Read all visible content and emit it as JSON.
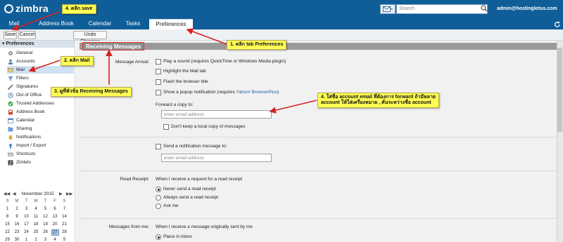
{
  "app": {
    "logo_text": "zimbra",
    "user": "admin@hostinglotus.com"
  },
  "search": {
    "placeholder": "Search"
  },
  "tabs": [
    {
      "label": "Mail"
    },
    {
      "label": "Address Book"
    },
    {
      "label": "Calendar"
    },
    {
      "label": "Tasks"
    },
    {
      "label": "Preferences"
    }
  ],
  "toolbar": {
    "save_label": "Save",
    "cancel_label": "Cancel",
    "undo_label": "Undo Changes"
  },
  "sidebar": {
    "header": "Preferences",
    "items": [
      {
        "label": "General",
        "icon": "gear-icon"
      },
      {
        "label": "Accounts",
        "icon": "person-icon"
      },
      {
        "label": "Mail",
        "icon": "envelope-icon"
      },
      {
        "label": "Filters",
        "icon": "filter-icon"
      },
      {
        "label": "Signatures",
        "icon": "pen-icon"
      },
      {
        "label": "Out of Office",
        "icon": "clock-icon"
      },
      {
        "label": "Trusted Addresses",
        "icon": "check-icon"
      },
      {
        "label": "Address Book",
        "icon": "book-icon"
      },
      {
        "label": "Calendar",
        "icon": "calendar-icon"
      },
      {
        "label": "Sharing",
        "icon": "share-icon"
      },
      {
        "label": "Notifications",
        "icon": "bell-icon"
      },
      {
        "label": "Import / Export",
        "icon": "import-icon"
      },
      {
        "label": "Shortcuts",
        "icon": "keyboard-icon"
      },
      {
        "label": "Zimlets",
        "icon": "zimlet-icon"
      }
    ]
  },
  "calendar": {
    "title": "November 2015",
    "days": [
      "S",
      "M",
      "T",
      "W",
      "T",
      "F",
      "S"
    ],
    "rows": [
      [
        "1",
        "2",
        "3",
        "4",
        "5",
        "6",
        "7"
      ],
      [
        "8",
        "9",
        "10",
        "11",
        "12",
        "13",
        "14"
      ],
      [
        "15",
        "16",
        "17",
        "18",
        "19",
        "20",
        "21"
      ],
      [
        "22",
        "23",
        "24",
        "25",
        "26",
        "27",
        "28"
      ],
      [
        "29",
        "30",
        "1",
        "2",
        "3",
        "4",
        "5"
      ]
    ],
    "today": "27"
  },
  "section": {
    "title": "Receiving Messages"
  },
  "message_arrival": {
    "label": "Message Arrival:",
    "options": [
      "Play a sound (requires QuickTime or Windows Media plugin)",
      "Highlight the Mail tab",
      "Flash the browser title"
    ],
    "popup_prefix": "Show a popup notification (requires ",
    "popup_link": "Yahoo! BrowserPlus",
    "popup_suffix": ")",
    "forward_label": "Forward a copy to:",
    "forward_placeholder": "enter email address",
    "dont_keep": "Don't keep a local copy of messages",
    "notify_label": "Send a notification message to:",
    "notify_placeholder": "enter email address"
  },
  "read_receipt": {
    "label": "Read Receipt:",
    "intro": "When I receive a request for a read receipt",
    "options": [
      "Never send a read receipt",
      "Always send a read receipt",
      "Ask me"
    ]
  },
  "messages_from_me": {
    "label": "Messages from me:",
    "intro": "When I receive a message originally sent by me",
    "options": [
      "Place in Inbox"
    ]
  },
  "annotations": {
    "step1": "1. คลิก tab Preferences",
    "step2": "2. คลิก Mail",
    "step3": "3. ดูที่หัวข้อ Receiving Messages",
    "step4": "4. คลิก save",
    "step4b_line1": "4. ใส่ชื่อ account email ที่ต้องการ forward ถ้ามีหลาย",
    "step4b_line2": "account ให้ใส่เครื่องหมาย , คั่นระหว่างชื่อ account"
  }
}
